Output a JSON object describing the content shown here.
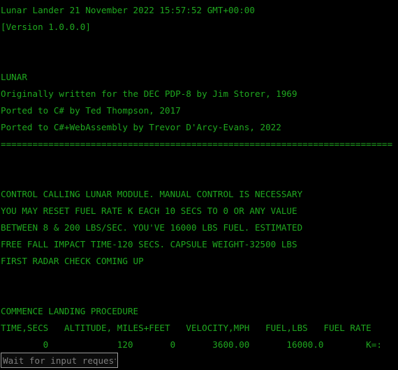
{
  "window": {
    "title": "Lunar Lander",
    "background_color": "#000000",
    "text_color": "#1fa81f"
  },
  "console": {
    "header_line": "Lunar Lander 21 November 2022 15:57:52 GMT+00:00",
    "version_line": "[Version 1.0.0.0]",
    "program_name": "LUNAR",
    "credits": [
      "Originally written for the DEC PDP-8 by Jim Storer, 1969",
      "Ported to C# by Ted Thompson, 2017",
      "Ported to C#+WebAssembly by Trevor D'Arcy-Evans, 2022"
    ],
    "separator": "==========================================================================",
    "instructions": [
      "CONTROL CALLING LUNAR MODULE. MANUAL CONTROL IS NECESSARY",
      "YOU MAY RESET FUEL RATE K EACH 10 SECS TO 0 OR ANY VALUE",
      "BETWEEN 8 & 200 LBS/SEC. YOU'VE 16000 LBS FUEL. ESTIMATED",
      "FREE FALL IMPACT TIME-120 SECS. CAPSULE WEIGHT-32500 LBS",
      "FIRST RADAR CHECK COMING UP"
    ],
    "commence_line": "COMMENCE LANDING PROCEDURE",
    "table_header": "TIME,SECS   ALTITUDE, MILES+FEET   VELOCITY,MPH   FUEL,LBS   FUEL RATE",
    "table_row": "        0             120       0       3600.00       16000.0        K=:"
  },
  "telemetry": {
    "columns": [
      "TIME,SECS",
      "ALTITUDE, MILES+FEET",
      "VELOCITY,MPH",
      "FUEL,LBS",
      "FUEL RATE"
    ],
    "rows": [
      {
        "time_secs": "0",
        "altitude_miles": "120",
        "altitude_feet": "0",
        "velocity_mph": "3600.00",
        "fuel_lbs": "16000.0",
        "fuel_rate": "K=:"
      }
    ]
  },
  "input": {
    "placeholder": "Wait for input request",
    "value": ""
  }
}
